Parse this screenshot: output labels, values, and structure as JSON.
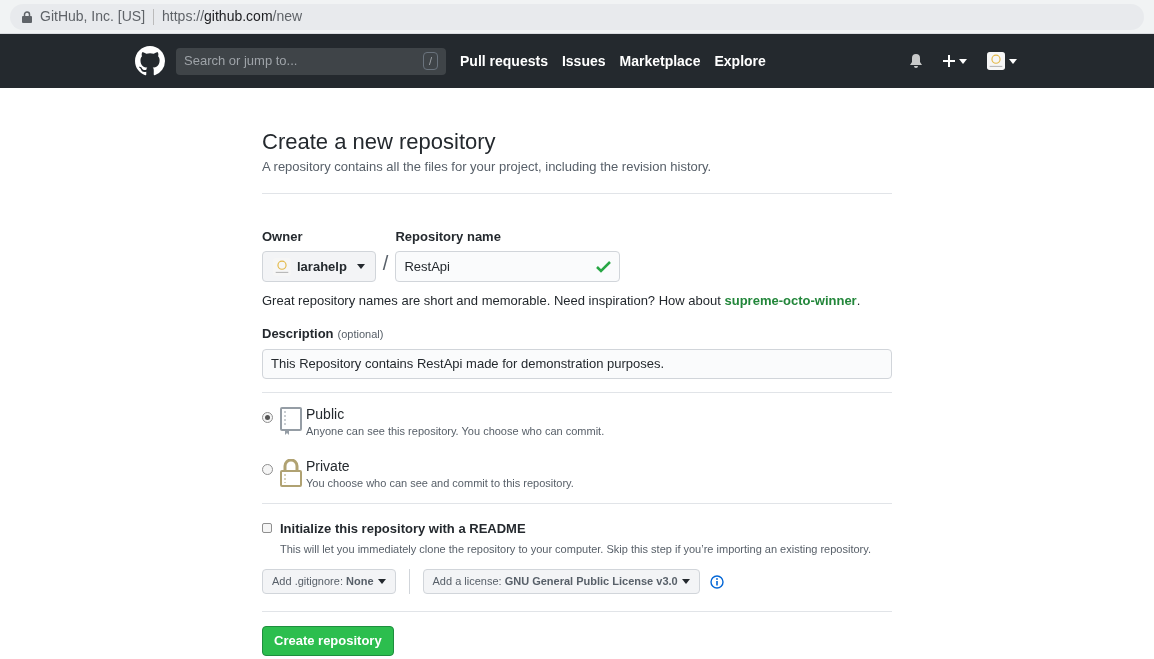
{
  "browser": {
    "site_identity": "GitHub, Inc. [US]",
    "url_scheme": "https://",
    "url_host": "github.com",
    "url_path": "/new"
  },
  "navbar": {
    "search_placeholder": "Search or jump to...",
    "search_key": "/",
    "links": [
      "Pull requests",
      "Issues",
      "Marketplace",
      "Explore"
    ]
  },
  "page": {
    "title": "Create a new repository",
    "subtitle": "A repository contains all the files for your project, including the revision history.",
    "owner": {
      "label": "Owner",
      "value": "larahelp"
    },
    "separator": "/",
    "repo_name": {
      "label": "Repository name",
      "value": "RestApi",
      "valid": true
    },
    "hint": {
      "text": "Great repository names are short and memorable. Need inspiration? How about",
      "suggestion": "supreme-octo-winner",
      "end": "."
    },
    "description": {
      "label": "Description",
      "note": "(optional)",
      "value": "This Repository contains RestApi made for demonstration purposes."
    },
    "visibility": [
      {
        "kind": "public",
        "label": "Public",
        "detail": "Anyone can see this repository. You choose who can commit.",
        "selected": true
      },
      {
        "kind": "private",
        "label": "Private",
        "detail": "You choose who can see and commit to this repository.",
        "selected": false
      }
    ],
    "readme": {
      "label": "Initialize this repository with a README",
      "detail": "This will let you immediately clone the repository to your computer. Skip this step if you’re importing an existing repository.",
      "checked": false
    },
    "gitignore": "Add .gitignore: **None**",
    "license": "Add a license: **GNU General Public License v3.0**",
    "submit": "Create repository"
  }
}
